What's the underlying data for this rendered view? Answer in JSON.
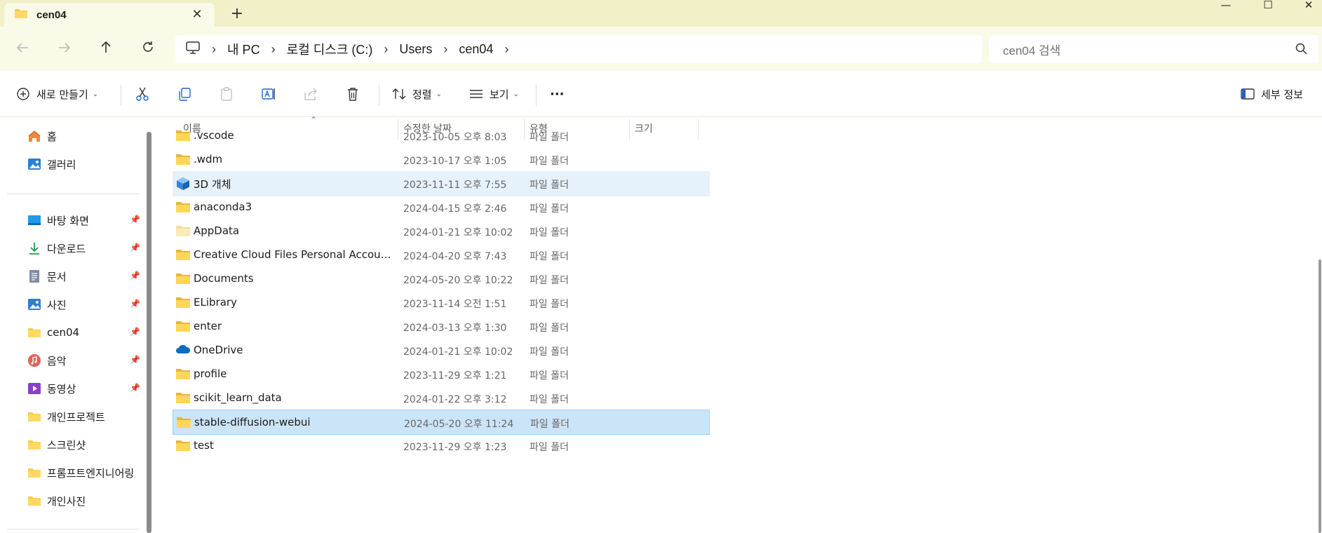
{
  "window": {
    "tab_title": "cen04",
    "tab_close": "✕",
    "new_tab": "+",
    "minimize": "—",
    "maximize": "☐",
    "close": "✕"
  },
  "nav": {
    "breadcrumbs": [
      "내 PC",
      "로컬 디스크 (C:)",
      "Users",
      "cen04"
    ],
    "search_placeholder": "cen04 검색"
  },
  "toolbar": {
    "new_label": "새로 만들기",
    "sort_label": "정렬",
    "view_label": "보기",
    "more_label": "···",
    "details_label": "세부 정보"
  },
  "sidebar": {
    "top_items": [
      {
        "label": "홈",
        "icon": "home-icon"
      },
      {
        "label": "갤러리",
        "icon": "gallery-icon"
      }
    ],
    "pinned_items": [
      {
        "label": "바탕 화면",
        "icon": "desktop-icon",
        "pinned": true
      },
      {
        "label": "다운로드",
        "icon": "download-icon",
        "pinned": true
      },
      {
        "label": "문서",
        "icon": "document-icon",
        "pinned": true
      },
      {
        "label": "사진",
        "icon": "pictures-icon",
        "pinned": true
      },
      {
        "label": "cen04",
        "icon": "folder-icon",
        "pinned": true
      },
      {
        "label": "음악",
        "icon": "music-icon",
        "pinned": true
      },
      {
        "label": "동영상",
        "icon": "video-icon",
        "pinned": true
      },
      {
        "label": "개인프로젝트",
        "icon": "folder-icon",
        "pinned": false
      },
      {
        "label": "스크린샷",
        "icon": "folder-icon",
        "pinned": false
      },
      {
        "label": "프롬프트엔지니어링",
        "icon": "folder-icon",
        "pinned": false
      },
      {
        "label": "개인사진",
        "icon": "folder-icon",
        "pinned": false
      }
    ]
  },
  "columns": {
    "name": "이름",
    "modified": "수정한 날짜",
    "type": "유형",
    "size": "크기"
  },
  "files": [
    {
      "name": ".vscode",
      "modified": "2023-10-05 오후 8:03",
      "type": "파일 폴더",
      "icon": "folder-icon",
      "state": "none"
    },
    {
      "name": ".wdm",
      "modified": "2023-10-17 오후 1:05",
      "type": "파일 폴더",
      "icon": "folder-icon",
      "state": "none"
    },
    {
      "name": "3D 개체",
      "modified": "2023-11-11 오후 7:55",
      "type": "파일 폴더",
      "icon": "3d-objects-icon",
      "state": "hover"
    },
    {
      "name": "anaconda3",
      "modified": "2024-04-15 오후 2:46",
      "type": "파일 폴더",
      "icon": "folder-icon",
      "state": "none"
    },
    {
      "name": "AppData",
      "modified": "2024-01-21 오후 10:02",
      "type": "파일 폴더",
      "icon": "folder-hidden-icon",
      "state": "none"
    },
    {
      "name": "Creative Cloud Files Personal Account c...",
      "modified": "2024-04-20 오후 7:43",
      "type": "파일 폴더",
      "icon": "folder-icon",
      "state": "none"
    },
    {
      "name": "Documents",
      "modified": "2024-05-20 오후 10:22",
      "type": "파일 폴더",
      "icon": "folder-icon",
      "state": "none"
    },
    {
      "name": "ELibrary",
      "modified": "2023-11-14 오전 1:51",
      "type": "파일 폴더",
      "icon": "folder-icon",
      "state": "none"
    },
    {
      "name": "enter",
      "modified": "2024-03-13 오후 1:30",
      "type": "파일 폴더",
      "icon": "folder-icon",
      "state": "none"
    },
    {
      "name": "OneDrive",
      "modified": "2024-01-21 오후 10:02",
      "type": "파일 폴더",
      "icon": "onedrive-icon",
      "state": "none"
    },
    {
      "name": "profile",
      "modified": "2023-11-29 오후 1:21",
      "type": "파일 폴더",
      "icon": "folder-icon",
      "state": "none"
    },
    {
      "name": "scikit_learn_data",
      "modified": "2024-01-22 오후 3:12",
      "type": "파일 폴더",
      "icon": "folder-icon",
      "state": "none"
    },
    {
      "name": "stable-diffusion-webui",
      "modified": "2024-05-20 오후 11:24",
      "type": "파일 폴더",
      "icon": "folder-icon",
      "state": "selected"
    },
    {
      "name": "test",
      "modified": "2023-11-29 오후 1:23",
      "type": "파일 폴더",
      "icon": "folder-icon",
      "state": "none"
    }
  ],
  "colors": {
    "titlebar_bg": "#f1f0c8",
    "navrow_bg": "#fafae8",
    "folder_yellow": "#f8c94a",
    "selected_bg": "#cce4f7",
    "hover_bg": "#e5f1fb",
    "accent_blue": "#0078d4"
  }
}
